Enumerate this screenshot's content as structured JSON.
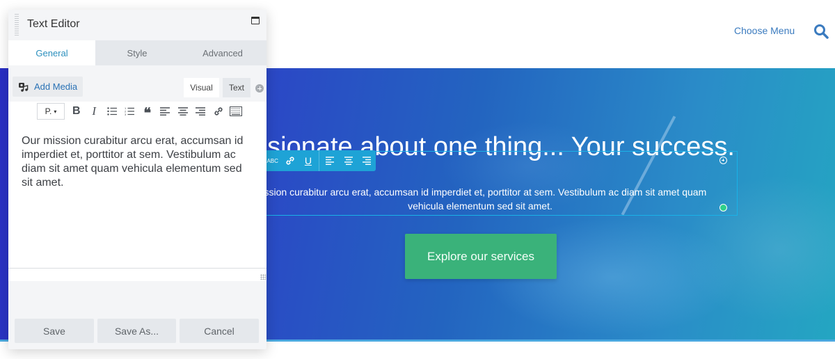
{
  "site": {
    "nav_label": "Choose Menu",
    "search_icon": "search-icon",
    "accent_color": "#3b7bbf"
  },
  "hero": {
    "title": "assionate about one thing... Your success.",
    "body": "mission curabitur arcu erat, accumsan id imperdiet et, porttitor at sem. Vestibulum ac diam sit amet quam vehicula elementum sed sit amet.",
    "cta_label": "Explore our services",
    "cta_color": "#3ab27a",
    "inline_toolbar": {
      "items": [
        {
          "icon": "strikethrough-icon",
          "glyph": "ABC"
        },
        {
          "icon": "link-icon",
          "glyph": "🔗"
        },
        {
          "icon": "underline-icon",
          "glyph": "U"
        },
        {
          "icon": "align-left-icon",
          "glyph": "≡"
        },
        {
          "icon": "align-center-icon",
          "glyph": "≡"
        },
        {
          "icon": "align-right-icon",
          "glyph": "≡"
        }
      ]
    }
  },
  "panel": {
    "title": "Text Editor",
    "tabs": [
      {
        "label": "General",
        "active": true
      },
      {
        "label": "Style",
        "active": false
      },
      {
        "label": "Advanced",
        "active": false
      }
    ],
    "add_media_label": "Add Media",
    "mode_tabs": {
      "visual": "Visual",
      "text": "Text"
    },
    "format_select": {
      "value": "P.",
      "caret": "▾"
    },
    "toolbar": {
      "bold": "B",
      "italic": "I",
      "quote": "❝"
    },
    "content": "Our mission curabitur arcu erat, accumsan id imperdiet et, porttitor at sem. Vestibulum ac diam sit amet quam vehicula elementum sed sit amet.",
    "buttons": {
      "save": "Save",
      "save_as": "Save As...",
      "cancel": "Cancel"
    },
    "active_tab_color": "#2a8fbd"
  }
}
